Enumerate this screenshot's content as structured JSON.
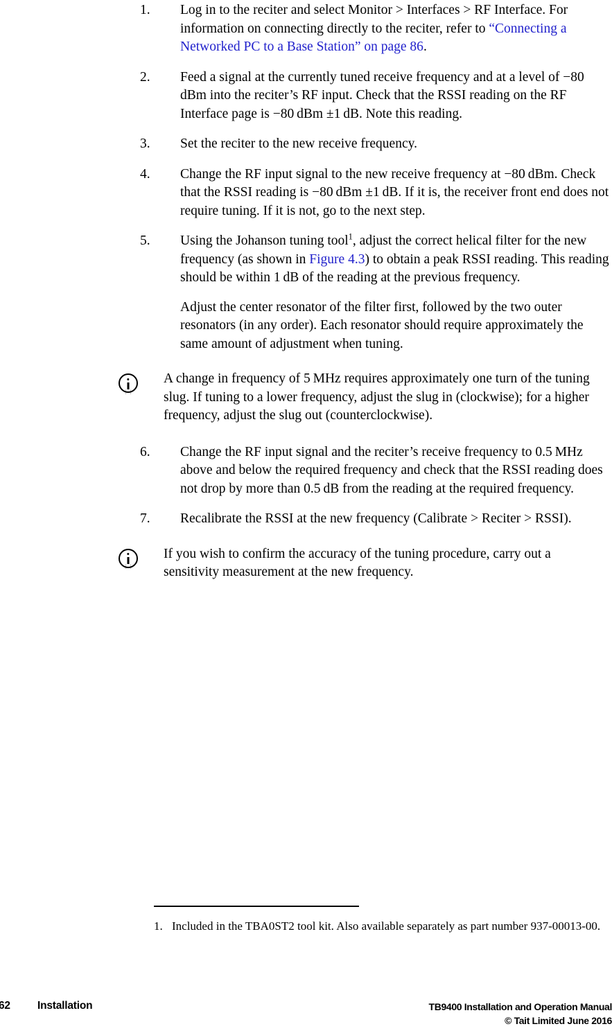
{
  "document": {
    "type": "manual-page",
    "link_color": "#2222cc",
    "text_color": "#000000",
    "background": "#ffffff"
  },
  "steps": [
    {
      "number": "1.",
      "paragraphs": [
        {
          "runs": [
            {
              "text": "Log in to the reciter and select Monitor > Interfaces > RF Interface. For information on connecting directly to the reciter, refer to ",
              "style": "normal"
            },
            {
              "text": "“Connecting a Networked PC to a Base Station” on page 86",
              "style": "link"
            },
            {
              "text": ".",
              "style": "normal"
            }
          ]
        }
      ]
    },
    {
      "number": "2.",
      "paragraphs": [
        {
          "runs": [
            {
              "text": "Feed a signal at the currently tuned receive frequency and at a level of −80 dBm into the reciter’s RF input. Check that the RSSI reading on the RF Interface page is −80 dBm ±1 dB. Note this reading.",
              "style": "normal"
            }
          ]
        }
      ]
    },
    {
      "number": "3.",
      "paragraphs": [
        {
          "runs": [
            {
              "text": "Set the reciter to the new receive frequency.",
              "style": "normal"
            }
          ]
        }
      ]
    },
    {
      "number": "4.",
      "paragraphs": [
        {
          "runs": [
            {
              "text": "Change the RF input signal to the new receive frequency at −80 dBm. Check that the RSSI reading is −80 dBm ±1 dB. If it is, the receiver front end does not require tuning. If it is not, go to the next step.",
              "style": "normal"
            }
          ]
        }
      ]
    },
    {
      "number": "5.",
      "paragraphs": [
        {
          "runs": [
            {
              "text": "Using the Johanson tuning tool",
              "style": "normal"
            },
            {
              "text": "1",
              "style": "footnote-marker"
            },
            {
              "text": ", adjust the correct helical filter for the new frequency (as shown in ",
              "style": "normal"
            },
            {
              "text": "Figure 4.3",
              "style": "link"
            },
            {
              "text": ") to obtain a peak RSSI reading. This reading should be within 1 dB of the reading at the previous frequency.",
              "style": "normal"
            }
          ]
        },
        {
          "runs": [
            {
              "text": "Adjust the center resonator of the filter first, followed by the two outer resonators (in any order). Each resonator should require approximately the same amount of adjustment when tuning.",
              "style": "normal"
            }
          ]
        }
      ]
    },
    {
      "number": "6.",
      "paragraphs": [
        {
          "runs": [
            {
              "text": "Change the RF input signal and the reciter’s receive frequency to 0.5 MHz above and below the required frequency and check that the RSSI reading does not drop by more than 0.5 dB from the reading at the required frequency.",
              "style": "normal"
            }
          ]
        }
      ]
    },
    {
      "number": "7.",
      "paragraphs": [
        {
          "runs": [
            {
              "text": "Recalibrate the RSSI at the new frequency (Calibrate > Reciter > RSSI).",
              "style": "normal"
            }
          ]
        }
      ]
    }
  ],
  "notes": [
    {
      "icon": "info-icon",
      "text": "A change in frequency of 5 MHz requires approximately one turn of the tuning slug. If tuning to a lower frequency, adjust the slug in (clockwise); for a higher frequency, adjust the slug out (counterclockwise)."
    },
    {
      "icon": "info-icon",
      "text": "If you wish to confirm the accuracy of the tuning procedure, carry out a sensitivity measurement at the new frequency."
    }
  ],
  "footnote": {
    "number": "1.",
    "text": "Included in the TBA0ST2 tool kit. Also available separately as part number 937-00013-00."
  },
  "page_footer": {
    "page_number": "62",
    "section": "Installation",
    "manual_title": "TB9400 Installation and Operation Manual",
    "copyright": "© Tait Limited June 2016"
  }
}
